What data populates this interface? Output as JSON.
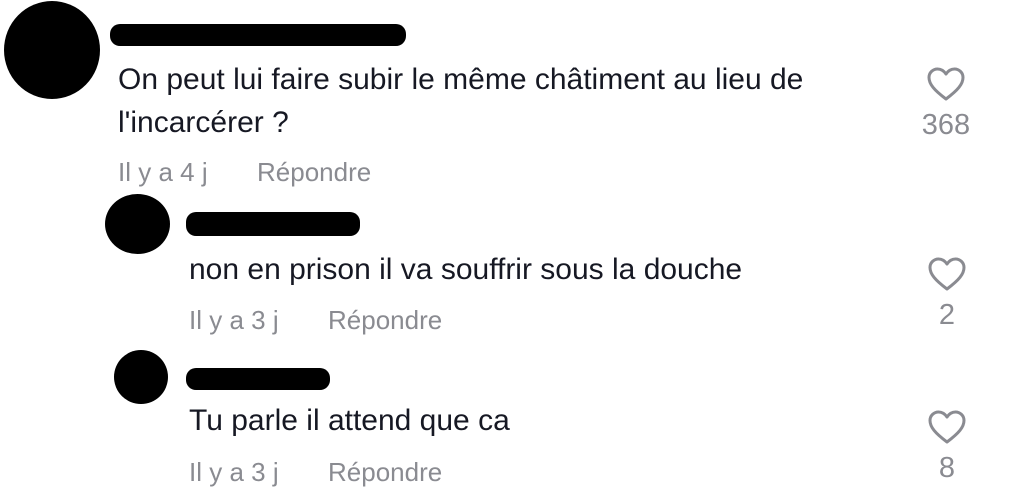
{
  "comments": [
    {
      "text": "On peut lui faire subir le même châtiment au lieu de l'incarcérer ?",
      "time": "Il y a 4 j",
      "reply_label": "Répondre",
      "likes": "368"
    }
  ],
  "replies": [
    {
      "text": "non en prison il va souffrir sous la douche",
      "time": "Il y a 3 j",
      "reply_label": "Répondre",
      "likes": "2"
    },
    {
      "text": "Tu parle il attend que ca",
      "time": "Il y a 3 j",
      "reply_label": "Répondre",
      "likes": "8"
    }
  ],
  "icons": {
    "like": "heart-outline-icon"
  },
  "colors": {
    "text": "#161823",
    "meta": "#8a8b91",
    "redaction": "#000000"
  }
}
